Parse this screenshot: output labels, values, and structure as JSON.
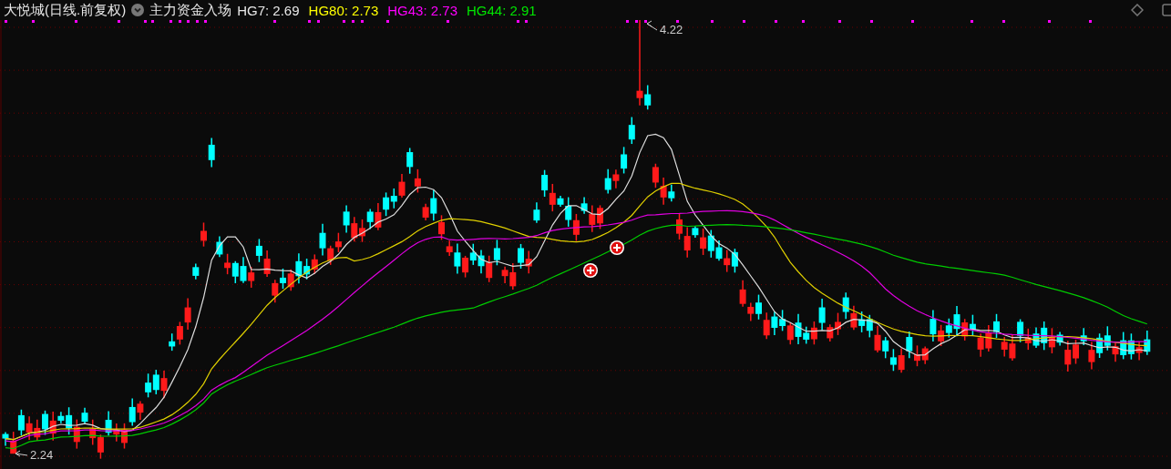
{
  "header": {
    "title": "大悦城(日线.前复权)",
    "indicator": "主力资金入场",
    "values": [
      {
        "text": "HG7: 2.69",
        "color": "#e8e8e8"
      },
      {
        "text": "HG80: 2.73",
        "color": "#ffff00"
      },
      {
        "text": "HG43: 2.73",
        "color": "#ff00ff"
      },
      {
        "text": "HG44: 2.91",
        "color": "#00e600"
      }
    ]
  },
  "chart": {
    "high_label": "4.22",
    "low_label": "2.24"
  }
}
